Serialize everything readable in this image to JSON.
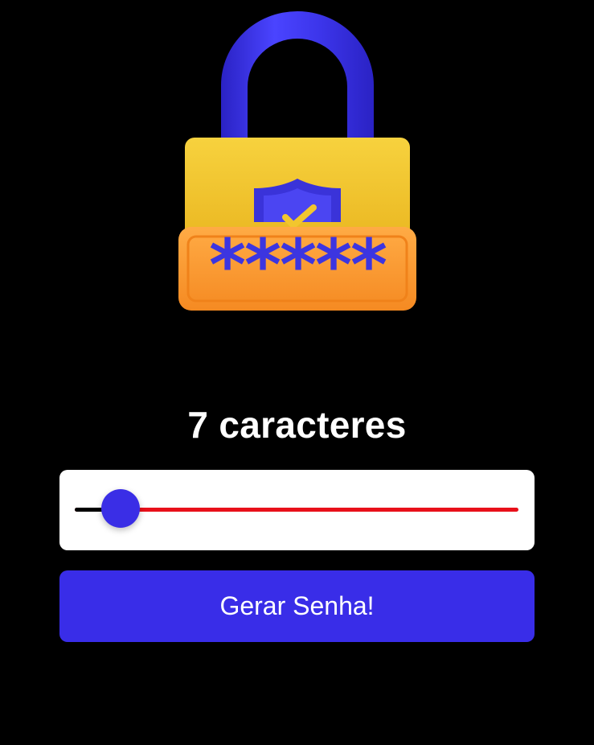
{
  "header": {
    "illustration_icon": "padlock-password-shield-icon",
    "password_mask": "*****"
  },
  "length": {
    "title": "7 caracteres",
    "value": 7,
    "slider_fraction": 0.104
  },
  "actions": {
    "generate_label": "Gerar Senha!"
  },
  "colors": {
    "background": "#000000",
    "accent": "#392de8",
    "track_active": "#000000",
    "track_inactive": "#e8101a",
    "lock_body": "#f2c62e",
    "lock_plate": "#ff9a33",
    "lock_shackle": "#3a33d9"
  }
}
